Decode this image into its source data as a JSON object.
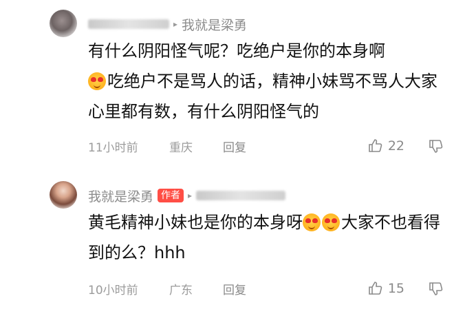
{
  "comments": [
    {
      "reply_to": "我就是梁勇",
      "text_line1": "有什么阴阳怪气呢？吃绝户是你的本身啊",
      "text_line2": "吃绝户不是骂人的话，精神小妹骂不骂人大家心里都有数，有什么阴阳怪气的",
      "time": "11小时前",
      "location": "重庆",
      "reply_label": "回复",
      "likes": "22"
    },
    {
      "author": "我就是梁勇",
      "author_badge": "作者",
      "reply_arrow": "▸",
      "text_line1": "黄毛精神小妹也是你的本身呀",
      "text_line2": "大家不也看得到的么？hhh",
      "time": "10小时前",
      "location": "广东",
      "reply_label": "回复",
      "likes": "15"
    }
  ],
  "icons": {
    "like": "thumbs-up-icon",
    "dislike": "thumbs-down-icon",
    "emoji": "heart-eyes-emoji-icon"
  },
  "colors": {
    "badge_bg": "#ff4e45",
    "meta_text": "#9b9b9b",
    "body_text": "#111111"
  }
}
